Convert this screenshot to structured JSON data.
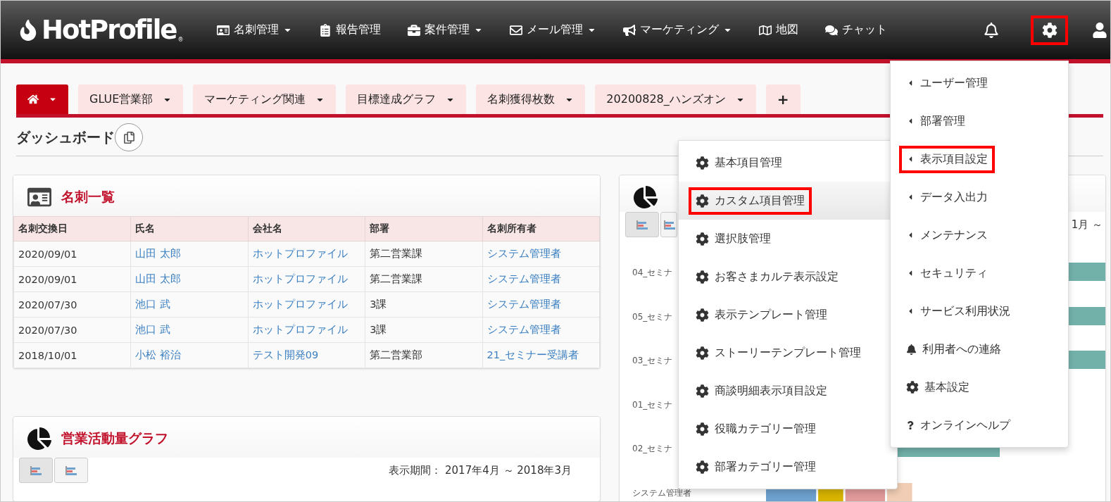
{
  "navbar": {
    "logo": "HotProfile",
    "logo_mark": "®",
    "items": [
      {
        "label": "名刺管理",
        "dropdown": true
      },
      {
        "label": "報告管理",
        "dropdown": false
      },
      {
        "label": "案件管理",
        "dropdown": true
      },
      {
        "label": "メール管理",
        "dropdown": true
      },
      {
        "label": "マーケティング",
        "dropdown": true
      },
      {
        "label": "地図",
        "dropdown": false
      },
      {
        "label": "チャット",
        "dropdown": false
      }
    ],
    "settings_highlighted": true
  },
  "tabs": [
    {
      "kind": "home",
      "selected": true
    },
    {
      "kind": "tab",
      "label": "GLUE営業部",
      "selected": false
    },
    {
      "kind": "tab",
      "label": "マーケティング関連",
      "selected": false
    },
    {
      "kind": "tab",
      "label": "目標達成グラフ",
      "selected": false
    },
    {
      "kind": "tab",
      "label": "名刺獲得枚数",
      "selected": false
    },
    {
      "kind": "tab",
      "label": "20200828_ハンズオン",
      "selected": false
    },
    {
      "kind": "add",
      "label": "+",
      "selected": false
    }
  ],
  "dashboard": {
    "title": "ダッシュボード"
  },
  "card_list": {
    "title": "名刺一覧",
    "columns": [
      "名刺交換日",
      "氏名",
      "会社名",
      "部署",
      "名刺所有者"
    ],
    "rows": [
      [
        "2020/09/01",
        "山田 太郎",
        "ホットプロファイル",
        "第二営業課",
        "システム管理者"
      ],
      [
        "2020/09/01",
        "山田 太郎",
        "ホットプロファイル",
        "第二営業課",
        "システム管理者"
      ],
      [
        "2020/07/30",
        "池口 武",
        "ホットプロファイル",
        "3課",
        "システム管理者"
      ],
      [
        "2020/07/30",
        "池口 武",
        "ホットプロファイル",
        "3課",
        "システム管理者"
      ],
      [
        "2018/10/01",
        "小松 裕治",
        "テスト開発09",
        "第二営業部",
        "21_セミナー受講者"
      ]
    ],
    "link_columns": [
      false,
      true,
      true,
      false,
      true
    ]
  },
  "activity_graph": {
    "title": "営業活動量グラフ",
    "period": "表示期間： 2017年4月 ～ 2018年3月"
  },
  "right_graph": {
    "period": "1月 ～",
    "labels": [
      "04_セミナ",
      "05_セミナ",
      "03_セミナ",
      "01_セミナ",
      "02_セミナ",
      "システム管理者"
    ]
  },
  "settings_menu": [
    {
      "label": "ユーザー管理",
      "kind": "submenu",
      "highlighted": false
    },
    {
      "label": "部署管理",
      "kind": "submenu",
      "highlighted": false
    },
    {
      "label": "表示項目設定",
      "kind": "submenu",
      "highlighted": true
    },
    {
      "label": "データ入出力",
      "kind": "submenu",
      "highlighted": false
    },
    {
      "label": "メンテナンス",
      "kind": "submenu",
      "highlighted": false
    },
    {
      "label": "セキュリティ",
      "kind": "submenu",
      "highlighted": false
    },
    {
      "label": "サービス利用状況",
      "kind": "submenu",
      "highlighted": false
    },
    {
      "label": "利用者への連絡",
      "kind": "notice",
      "highlighted": false
    },
    {
      "label": "基本設定",
      "kind": "settings",
      "highlighted": false
    },
    {
      "label": "オンラインヘルプ",
      "kind": "help",
      "highlighted": false
    }
  ],
  "submenu": [
    {
      "label": "基本項目管理",
      "selected": false,
      "highlighted": false
    },
    {
      "label": "カスタム項目管理",
      "selected": true,
      "highlighted": true
    },
    {
      "label": "選択肢管理",
      "selected": false,
      "highlighted": false
    },
    {
      "label": "お客さまカルテ表示設定",
      "selected": false,
      "highlighted": false
    },
    {
      "label": "表示テンプレート管理",
      "selected": false,
      "highlighted": false
    },
    {
      "label": "ストーリーテンプレート管理",
      "selected": false,
      "highlighted": false
    },
    {
      "label": "商談明細表示項目設定",
      "selected": false,
      "highlighted": false
    },
    {
      "label": "役職カテゴリー管理",
      "selected": false,
      "highlighted": false
    },
    {
      "label": "部署カテゴリー管理",
      "selected": false,
      "highlighted": false
    }
  ]
}
